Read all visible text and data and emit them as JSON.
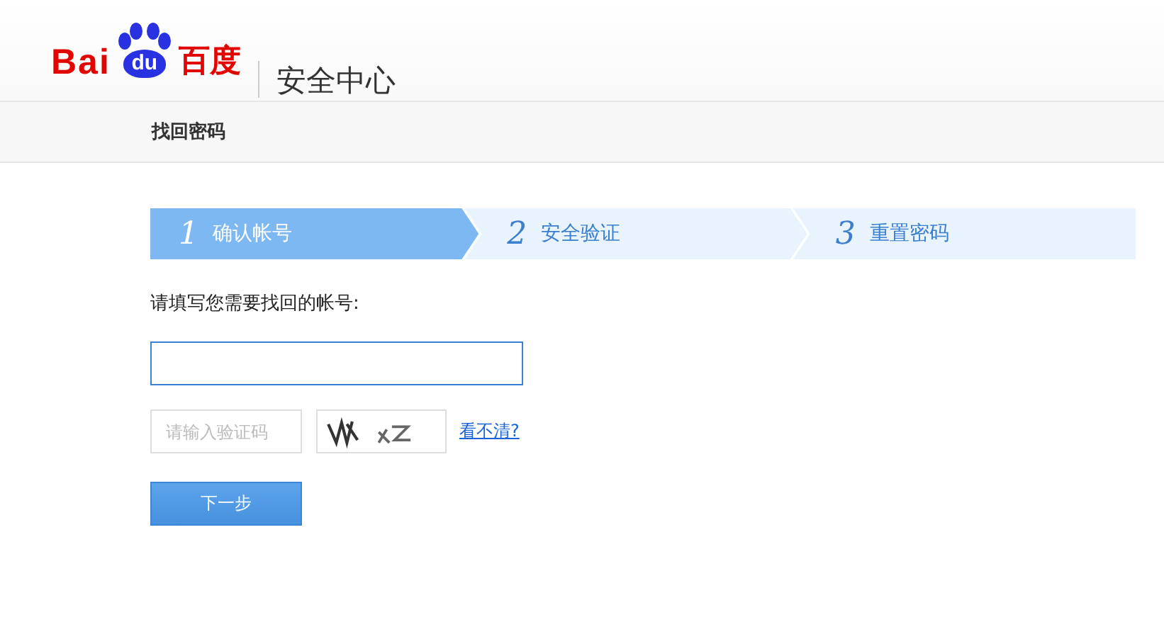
{
  "logo": {
    "part_1": "Bai",
    "part_2": "du",
    "part_3": "百度"
  },
  "header": {
    "title": "安全中心"
  },
  "nav": {
    "title": "找回密码"
  },
  "steps": [
    {
      "number": "1",
      "label": "确认帐号",
      "selected": true
    },
    {
      "number": "2",
      "label": "安全验证",
      "selected": false
    },
    {
      "number": "3",
      "label": "重置密码",
      "selected": false
    }
  ],
  "form": {
    "prompt": "请填写您需要找回的帐号:",
    "captcha_placeholder": "请输入验证码",
    "refresh_link": "看不清?",
    "submit": "下一步"
  }
}
